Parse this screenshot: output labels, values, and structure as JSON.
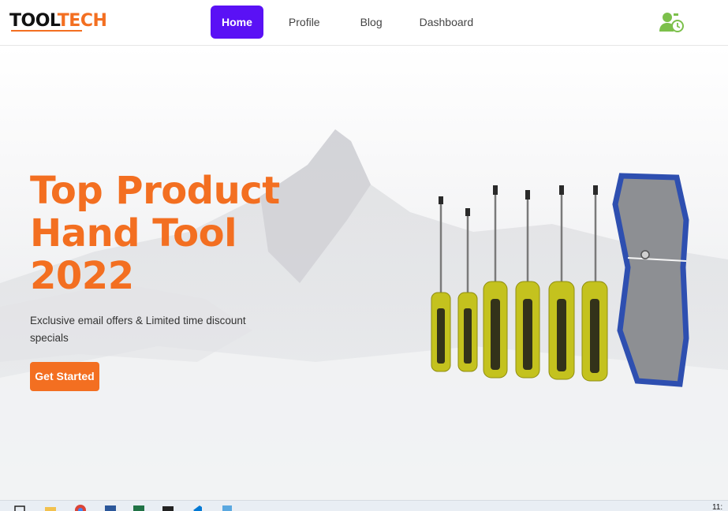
{
  "header": {
    "logo": {
      "part1": "TOOL",
      "part2": "TECH"
    },
    "nav": [
      {
        "label": "Home",
        "active": true
      },
      {
        "label": "Profile",
        "active": false
      },
      {
        "label": "Blog",
        "active": false
      },
      {
        "label": "Dashboard",
        "active": false
      }
    ],
    "user_icon": "user-clock-icon"
  },
  "hero": {
    "title": "Top Product\nHand Tool\n2022",
    "subtitle": "Exclusive email offers & Limited time discount specials",
    "cta_label": "Get Started",
    "product_image": "screwdriver-set-with-pouch"
  },
  "taskbar": {
    "icons": [
      "task-view-icon",
      "file-explorer-icon",
      "chrome-icon",
      "word-icon",
      "excel-icon",
      "terminal-icon",
      "vscode-icon",
      "app-icon"
    ],
    "time": "11:"
  },
  "colors": {
    "accent": "#f36f21",
    "nav_active": "#5a11f5",
    "user_icon": "#7cc04b"
  }
}
